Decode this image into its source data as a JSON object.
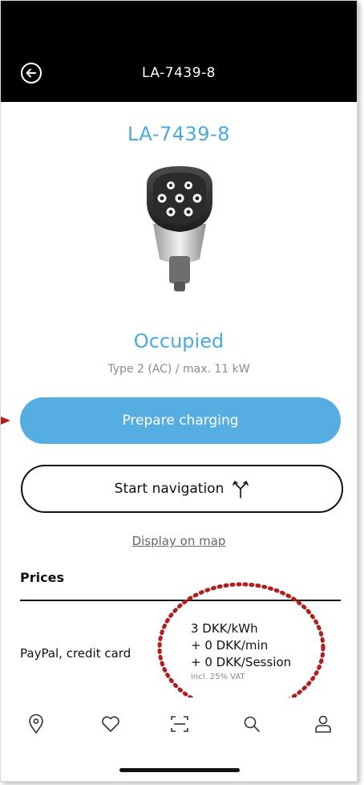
{
  "header": {
    "title": "LA-7439-8"
  },
  "station": {
    "id_label": "LA-7439-8",
    "status": "Occupied",
    "spec": "Type 2 (AC) / max. 11 kW"
  },
  "actions": {
    "prepare_label": "Prepare charging",
    "navigation_label": "Start navigation",
    "map_link": "Display on map"
  },
  "prices": {
    "heading": "Prices",
    "payment_methods": "PayPal, credit card",
    "lines": [
      "3 DKK/kWh",
      "+ 0 DKK/min",
      "+ 0 DKK/Session"
    ],
    "vat_note": "incl. 25% VAT"
  },
  "nav": {
    "items": [
      "location-pin-icon",
      "heart-icon",
      "scan-icon",
      "search-icon",
      "user-icon"
    ]
  },
  "colors": {
    "accent": "#4aa9e0",
    "button": "#56ade2",
    "annotation": "#b01e1e"
  }
}
